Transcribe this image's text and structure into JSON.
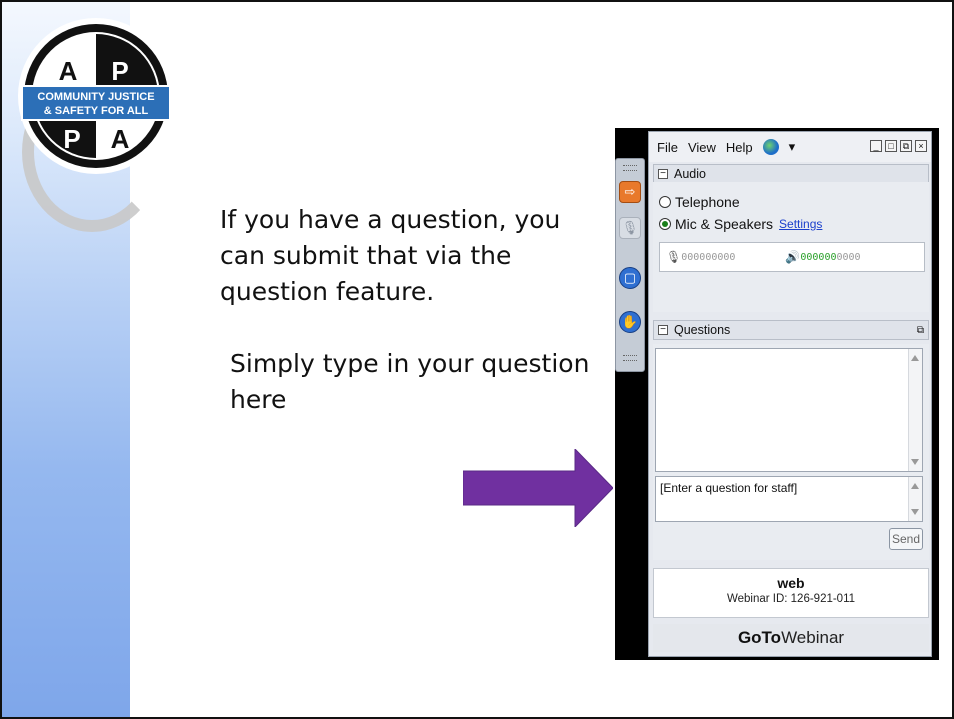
{
  "logo": {
    "letters": [
      "A",
      "P",
      "P",
      "A"
    ],
    "banner_line1": "COMMUNITY JUSTICE",
    "banner_line2": "& SAFETY FOR ALL"
  },
  "slide": {
    "paragraph1": "If you have a question, you can submit that via the question feature.",
    "paragraph2": "Simply type in your question here",
    "arrow_color": "#7030a0"
  },
  "menu": {
    "file": "File",
    "view": "View",
    "help": "Help",
    "globe_suffix": "▾"
  },
  "audio": {
    "header": "Audio",
    "option_telephone": "Telephone",
    "option_mic": "Mic & Speakers",
    "settings_link": "Settings",
    "mic_dots": "000000000",
    "speaker_dots_on": "000000",
    "speaker_dots_off": "0000"
  },
  "questions": {
    "header": "Questions",
    "input_placeholder": "[Enter a question for staff]",
    "send_label": "Send"
  },
  "footer": {
    "webinar_name": "web",
    "webinar_id": "Webinar ID: 126-921-011",
    "brand_bold": "GoTo",
    "brand_rest": "Webinar"
  },
  "colors": {
    "rail_orange": "#e8792b",
    "rail_blue": "#2f6fd1",
    "meter_green": "#2aa02a"
  }
}
